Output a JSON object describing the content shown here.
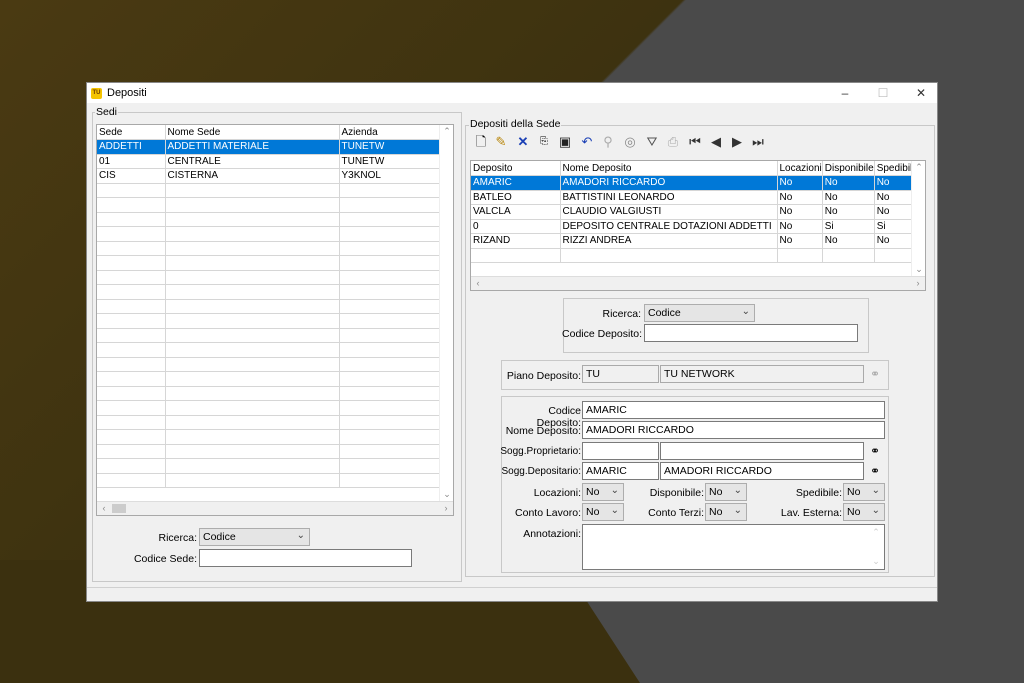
{
  "window": {
    "title": "Depositi",
    "app_icon_text": "TU"
  },
  "sedi": {
    "group_label": "Sedi",
    "columns": [
      "Sede",
      "Nome Sede",
      "Azienda"
    ],
    "rows": [
      [
        "ADDETTI",
        "ADDETTI MATERIALE",
        "TUNETW"
      ],
      [
        "01",
        "CENTRALE",
        "TUNETW"
      ],
      [
        "CIS",
        "CISTERNA",
        "Y3KNOL"
      ]
    ],
    "selected_row": 0,
    "ricerca_label": "Ricerca:",
    "ricerca_value": "Codice",
    "codice_label": "Codice Sede:",
    "codice_value": ""
  },
  "depositi": {
    "group_label": "Depositi della Sede",
    "columns": [
      "Deposito",
      "Nome Deposito",
      "Locazioni",
      "Disponibile",
      "Spedibile"
    ],
    "rows": [
      [
        "AMARIC",
        "AMADORI RICCARDO",
        "No",
        "No",
        "No"
      ],
      [
        "BATLEO",
        "BATTISTINI LEONARDO",
        "No",
        "No",
        "No"
      ],
      [
        "VALCLA",
        "CLAUDIO VALGIUSTI",
        "No",
        "No",
        "No"
      ],
      [
        "0",
        "DEPOSITO CENTRALE DOTAZIONI ADDETTI",
        "No",
        "Si",
        "Si"
      ],
      [
        "RIZAND",
        "RIZZI ANDREA",
        "No",
        "No",
        "No"
      ]
    ],
    "selected_row": 0,
    "ricerca_label": "Ricerca:",
    "ricerca_value": "Codice",
    "codice_label": "Codice Deposito:",
    "codice_value": ""
  },
  "piano": {
    "label": "Piano Deposito:",
    "code": "TU",
    "name": "TU  NETWORK"
  },
  "detail": {
    "codice_label": "Codice Deposito:",
    "codice_value": "AMARIC",
    "nome_label": "Nome Deposito:",
    "nome_value": "AMADORI RICCARDO",
    "proprietario_label": "Sogg.Proprietario:",
    "proprietario_code": "",
    "proprietario_name": "",
    "depositario_label": "Sogg.Depositario:",
    "depositario_code": "AMARIC",
    "depositario_name": "AMADORI RICCARDO",
    "locazioni_label": "Locazioni:",
    "locazioni_value": "No",
    "disponibile_label": "Disponibile:",
    "disponibile_value": "No",
    "spedibile_label": "Spedibile:",
    "spedibile_value": "No",
    "conto_lavoro_label": "Conto Lavoro:",
    "conto_lavoro_value": "No",
    "conto_terzi_label": "Conto Terzi:",
    "conto_terzi_value": "No",
    "lav_esterna_label": "Lav. Esterna:",
    "lav_esterna_value": "No",
    "annotazioni_label": "Annotazioni:"
  },
  "toolbar_icons": [
    "new-icon",
    "edit-icon",
    "delete-icon",
    "copy-icon",
    "save-icon",
    "undo-icon",
    "search-icon",
    "globe-icon",
    "filter-icon",
    "print-icon",
    "first-icon",
    "prev-icon",
    "next-icon",
    "last-icon"
  ],
  "colors": {
    "selection": "#0078d7",
    "window_bg": "#f0f0f0"
  }
}
